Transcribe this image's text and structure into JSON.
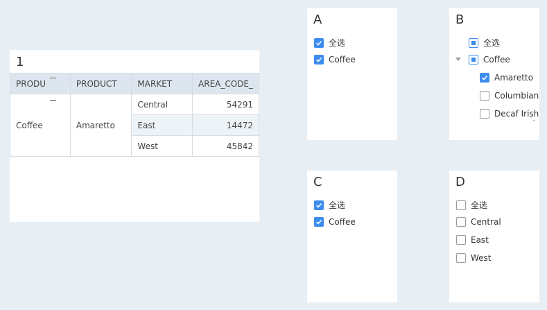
{
  "table_panel": {
    "title": "1",
    "headers": [
      "PRODU",
      "PRODUCT",
      "MARKET",
      "AREA_CODE_"
    ],
    "product_type": "Coffee",
    "product": "Amaretto",
    "rows": [
      {
        "market": "Central",
        "area_code": "54291"
      },
      {
        "market": "East",
        "area_code": "14472"
      },
      {
        "market": "West",
        "area_code": "45842"
      }
    ]
  },
  "panel_a": {
    "title": "A",
    "options": [
      {
        "label": "全选",
        "checked": true
      },
      {
        "label": "Coffee",
        "checked": true
      }
    ]
  },
  "panel_b": {
    "title": "B",
    "select_all": {
      "label": "全选",
      "state": "partial"
    },
    "group": {
      "label": "Coffee",
      "state": "partial",
      "expanded": true
    },
    "children": [
      {
        "label": "Amaretto",
        "checked": true
      },
      {
        "label": "Columbian",
        "checked": false
      },
      {
        "label": "Decaf Irish Cream",
        "checked": false
      }
    ]
  },
  "panel_c": {
    "title": "C",
    "options": [
      {
        "label": "全选",
        "checked": true
      },
      {
        "label": "Coffee",
        "checked": true
      }
    ]
  },
  "panel_d": {
    "title": "D",
    "options": [
      {
        "label": "全选",
        "checked": false
      },
      {
        "label": "Central",
        "checked": false
      },
      {
        "label": "East",
        "checked": false
      },
      {
        "label": "West",
        "checked": false
      }
    ]
  },
  "icons": {
    "check": "check-icon",
    "expand": "caret-down-icon",
    "collapse": "minus-icon"
  },
  "colors": {
    "accent": "#3d8cf0",
    "header_bg": "#dde6ef",
    "page_bg": "#e8eff4"
  }
}
